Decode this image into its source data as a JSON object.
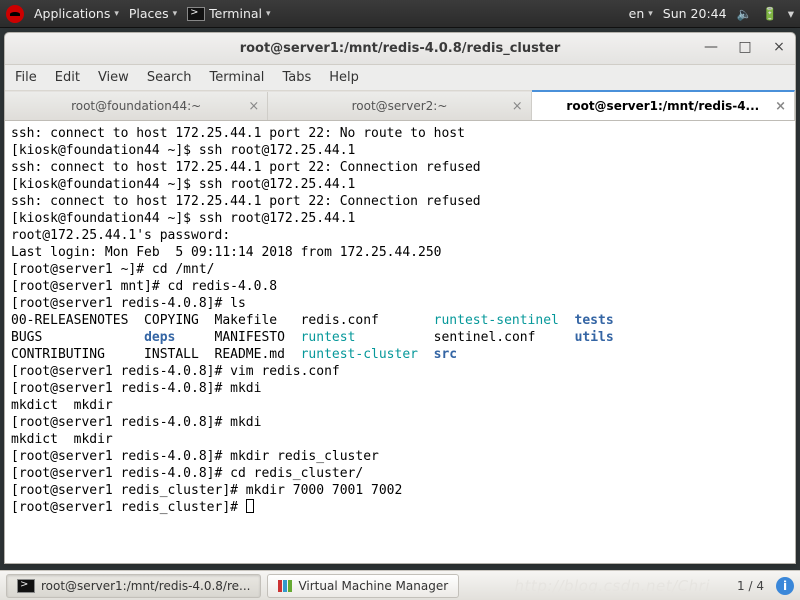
{
  "panel": {
    "applications": "Applications",
    "places": "Places",
    "terminal": "Terminal",
    "lang": "en",
    "clock": "Sun 20:44"
  },
  "window": {
    "title": "root@server1:/mnt/redis-4.0.8/redis_cluster",
    "menus": [
      "File",
      "Edit",
      "View",
      "Search",
      "Terminal",
      "Tabs",
      "Help"
    ],
    "controls": {
      "min": "—",
      "max": "□",
      "close": "×"
    }
  },
  "tabs": [
    {
      "label": "root@foundation44:~",
      "active": false
    },
    {
      "label": "root@server2:~",
      "active": false
    },
    {
      "label": "root@server1:/mnt/redis-4...",
      "active": true
    }
  ],
  "terminal_lines": [
    {
      "segs": [
        {
          "t": "ssh: connect to host 172.25.44.1 port 22: No route to host"
        }
      ]
    },
    {
      "segs": [
        {
          "t": "[kiosk@foundation44 ~]$ ssh root@172.25.44.1"
        }
      ]
    },
    {
      "segs": [
        {
          "t": "ssh: connect to host 172.25.44.1 port 22: Connection refused"
        }
      ]
    },
    {
      "segs": [
        {
          "t": "[kiosk@foundation44 ~]$ ssh root@172.25.44.1"
        }
      ]
    },
    {
      "segs": [
        {
          "t": "ssh: connect to host 172.25.44.1 port 22: Connection refused"
        }
      ]
    },
    {
      "segs": [
        {
          "t": "[kiosk@foundation44 ~]$ ssh root@172.25.44.1"
        }
      ]
    },
    {
      "segs": [
        {
          "t": "root@172.25.44.1's password:"
        }
      ]
    },
    {
      "segs": [
        {
          "t": "Last login: Mon Feb  5 09:11:14 2018 from 172.25.44.250"
        }
      ]
    },
    {
      "segs": [
        {
          "t": "[root@server1 ~]# cd /mnt/"
        }
      ]
    },
    {
      "segs": [
        {
          "t": "[root@server1 mnt]# cd redis-4.0.8"
        }
      ]
    },
    {
      "segs": [
        {
          "t": "[root@server1 redis-4.0.8]# ls"
        }
      ]
    },
    {
      "segs": [
        {
          "t": "00-RELEASENOTES  COPYING  Makefile   redis.conf       "
        },
        {
          "t": "runtest-sentinel",
          "cls": "c-teal"
        },
        {
          "t": "  "
        },
        {
          "t": "tests",
          "cls": "c-blue-b"
        }
      ]
    },
    {
      "segs": [
        {
          "t": "BUGS             "
        },
        {
          "t": "deps",
          "cls": "c-blue-b"
        },
        {
          "t": "     MANIFESTO  "
        },
        {
          "t": "runtest",
          "cls": "c-teal"
        },
        {
          "t": "          sentinel.conf     "
        },
        {
          "t": "utils",
          "cls": "c-blue-b"
        }
      ]
    },
    {
      "segs": [
        {
          "t": "CONTRIBUTING     INSTALL  README.md  "
        },
        {
          "t": "runtest-cluster",
          "cls": "c-teal"
        },
        {
          "t": "  "
        },
        {
          "t": "src",
          "cls": "c-blue-b"
        }
      ]
    },
    {
      "segs": [
        {
          "t": "[root@server1 redis-4.0.8]# vim redis.conf"
        }
      ]
    },
    {
      "segs": [
        {
          "t": "[root@server1 redis-4.0.8]# mkdi"
        }
      ]
    },
    {
      "segs": [
        {
          "t": "mkdict  mkdir"
        }
      ]
    },
    {
      "segs": [
        {
          "t": "[root@server1 redis-4.0.8]# mkdi"
        }
      ]
    },
    {
      "segs": [
        {
          "t": "mkdict  mkdir"
        }
      ]
    },
    {
      "segs": [
        {
          "t": "[root@server1 redis-4.0.8]# mkdir redis_cluster"
        }
      ]
    },
    {
      "segs": [
        {
          "t": "[root@server1 redis-4.0.8]# cd redis_cluster/"
        }
      ]
    },
    {
      "segs": [
        {
          "t": "[root@server1 redis_cluster]# mkdir 7000 7001 7002"
        }
      ]
    },
    {
      "segs": [
        {
          "t": "[root@server1 redis_cluster]# "
        }
      ],
      "cursor": true
    }
  ],
  "taskbar": {
    "task1": "root@server1:/mnt/redis-4.0.8/re...",
    "task2": "Virtual Machine Manager",
    "workspace": "1 / 4",
    "watermark": "http://blog.csdn.net/Chri"
  }
}
